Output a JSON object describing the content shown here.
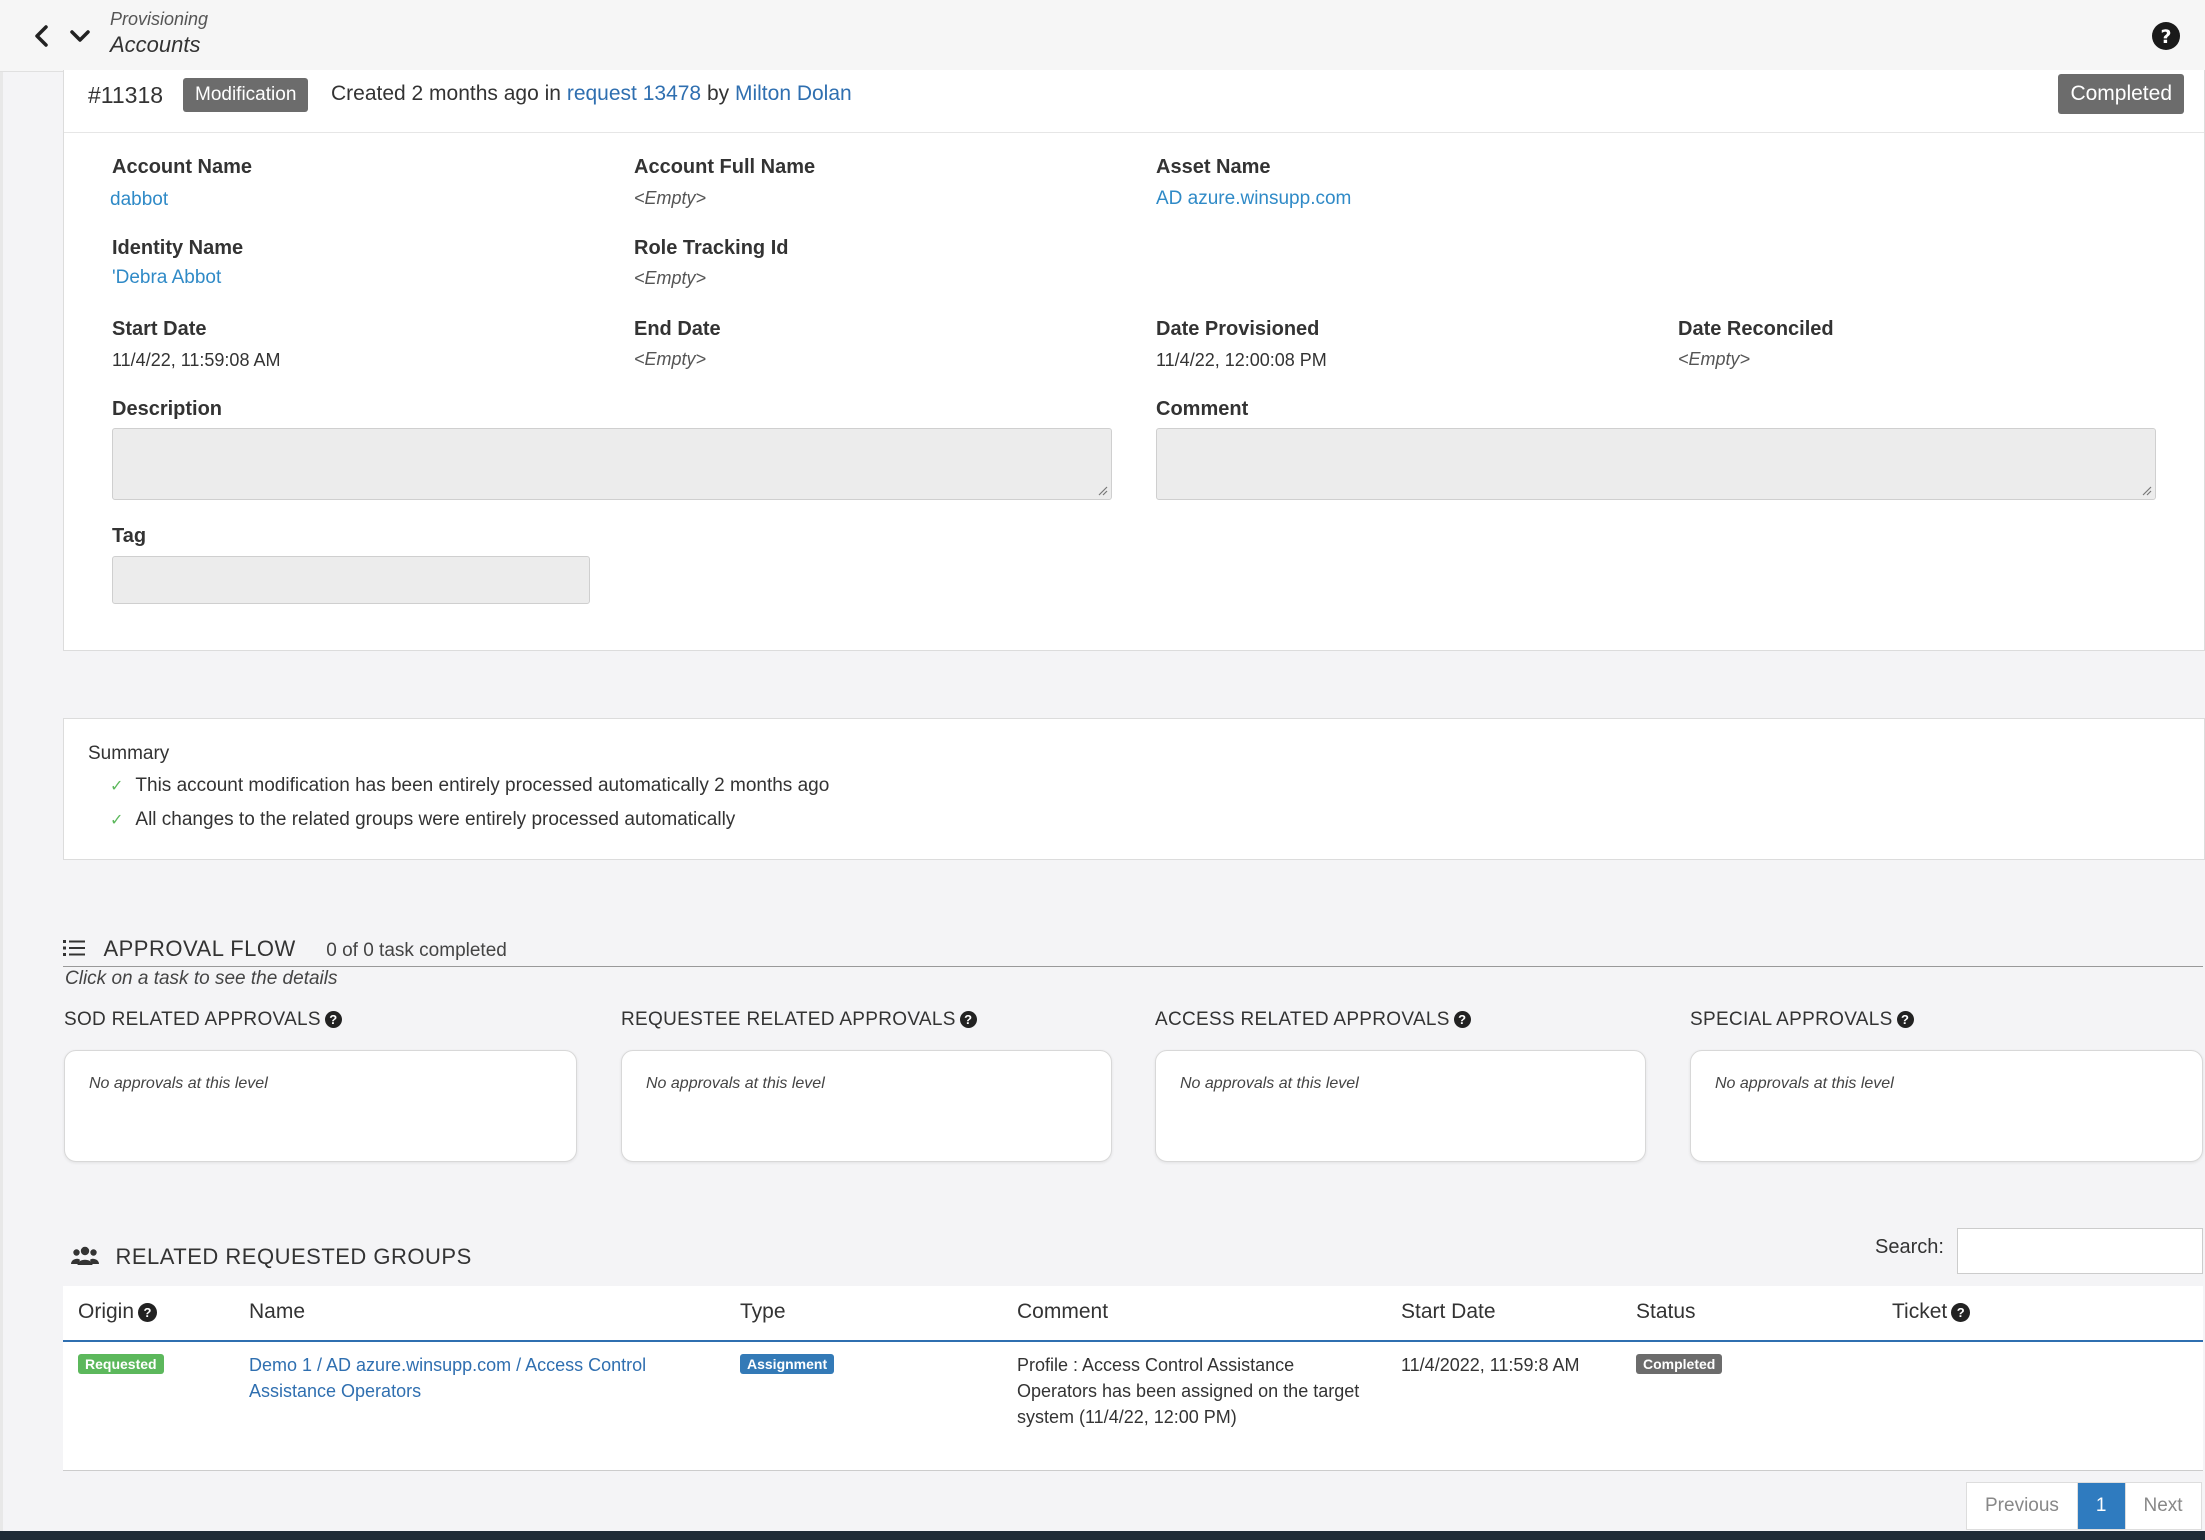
{
  "header": {
    "breadcrumb": "Provisioning",
    "title": "Accounts"
  },
  "record": {
    "id": "#11318",
    "type_badge": "Modification",
    "created_prefix": "Created 2 months ago in",
    "request_link": "request 13478",
    "by_text": "by",
    "user_link": "Milton Dolan",
    "status_badge": "Completed"
  },
  "fields": {
    "account_name_label": "Account Name",
    "account_name": "dabbot",
    "account_full_name_label": "Account Full Name",
    "account_full_name": "<Empty>",
    "asset_name_label": "Asset Name",
    "asset_name": "AD azure.winsupp.com",
    "identity_name_label": "Identity Name",
    "identity_name": "'Debra Abbot",
    "role_tracking_label": "Role Tracking Id",
    "role_tracking": "<Empty>",
    "start_date_label": "Start Date",
    "start_date": "11/4/22, 11:59:08 AM",
    "end_date_label": "End Date",
    "end_date": "<Empty>",
    "date_provisioned_label": "Date Provisioned",
    "date_provisioned": "11/4/22, 12:00:08 PM",
    "date_reconciled_label": "Date Reconciled",
    "date_reconciled": "<Empty>",
    "description_label": "Description",
    "comment_label": "Comment",
    "tag_label": "Tag"
  },
  "summary": {
    "title": "Summary",
    "lines": [
      "This account modification has been entirely processed automatically 2 months ago",
      "All changes to the related groups were entirely processed automatically"
    ]
  },
  "approval_flow": {
    "title": "APPROVAL FLOW",
    "progress": "0 of 0 task completed",
    "hint": "Click on a task to see the details",
    "columns": [
      {
        "title": "SOD RELATED APPROVALS",
        "empty": "No approvals at this level"
      },
      {
        "title": "REQUESTEE RELATED APPROVALS",
        "empty": "No approvals at this level"
      },
      {
        "title": "ACCESS RELATED APPROVALS",
        "empty": "No approvals at this level"
      },
      {
        "title": "SPECIAL APPROVALS",
        "empty": "No approvals at this level"
      }
    ]
  },
  "related_groups": {
    "title": "RELATED REQUESTED GROUPS",
    "search_label": "Search:",
    "search_value": "",
    "headers": [
      "Origin",
      "Name",
      "Type",
      "Comment",
      "Start Date",
      "Status",
      "Ticket"
    ],
    "rows": [
      {
        "origin": "Requested",
        "name_line1": "Demo 1 / AD azure.winsupp.com / Access Control",
        "name_line2": "Assistance Operators",
        "type": "Assignment",
        "comment_line1": "Profile : Access Control Assistance",
        "comment_line2": "Operators has been assigned on the target",
        "comment_line3": "system (11/4/22, 12:00 PM)",
        "start_date": "11/4/2022, 11:59:8 AM",
        "status": "Completed",
        "ticket": ""
      }
    ]
  },
  "pager": {
    "previous": "Previous",
    "current": "1",
    "next": "Next"
  },
  "colors": {
    "link": "#2f6fb0",
    "badge_gray": "#6c6c6c",
    "requested_green": "#5cb85c",
    "assignment_blue": "#337ab7",
    "pager_active": "#2f7bbf"
  },
  "icons": {
    "back": "chevron-left-icon",
    "menu": "chevron-down-icon",
    "help": "question-circle-icon",
    "list": "list-icon",
    "users": "users-icon",
    "check": "check-icon"
  }
}
